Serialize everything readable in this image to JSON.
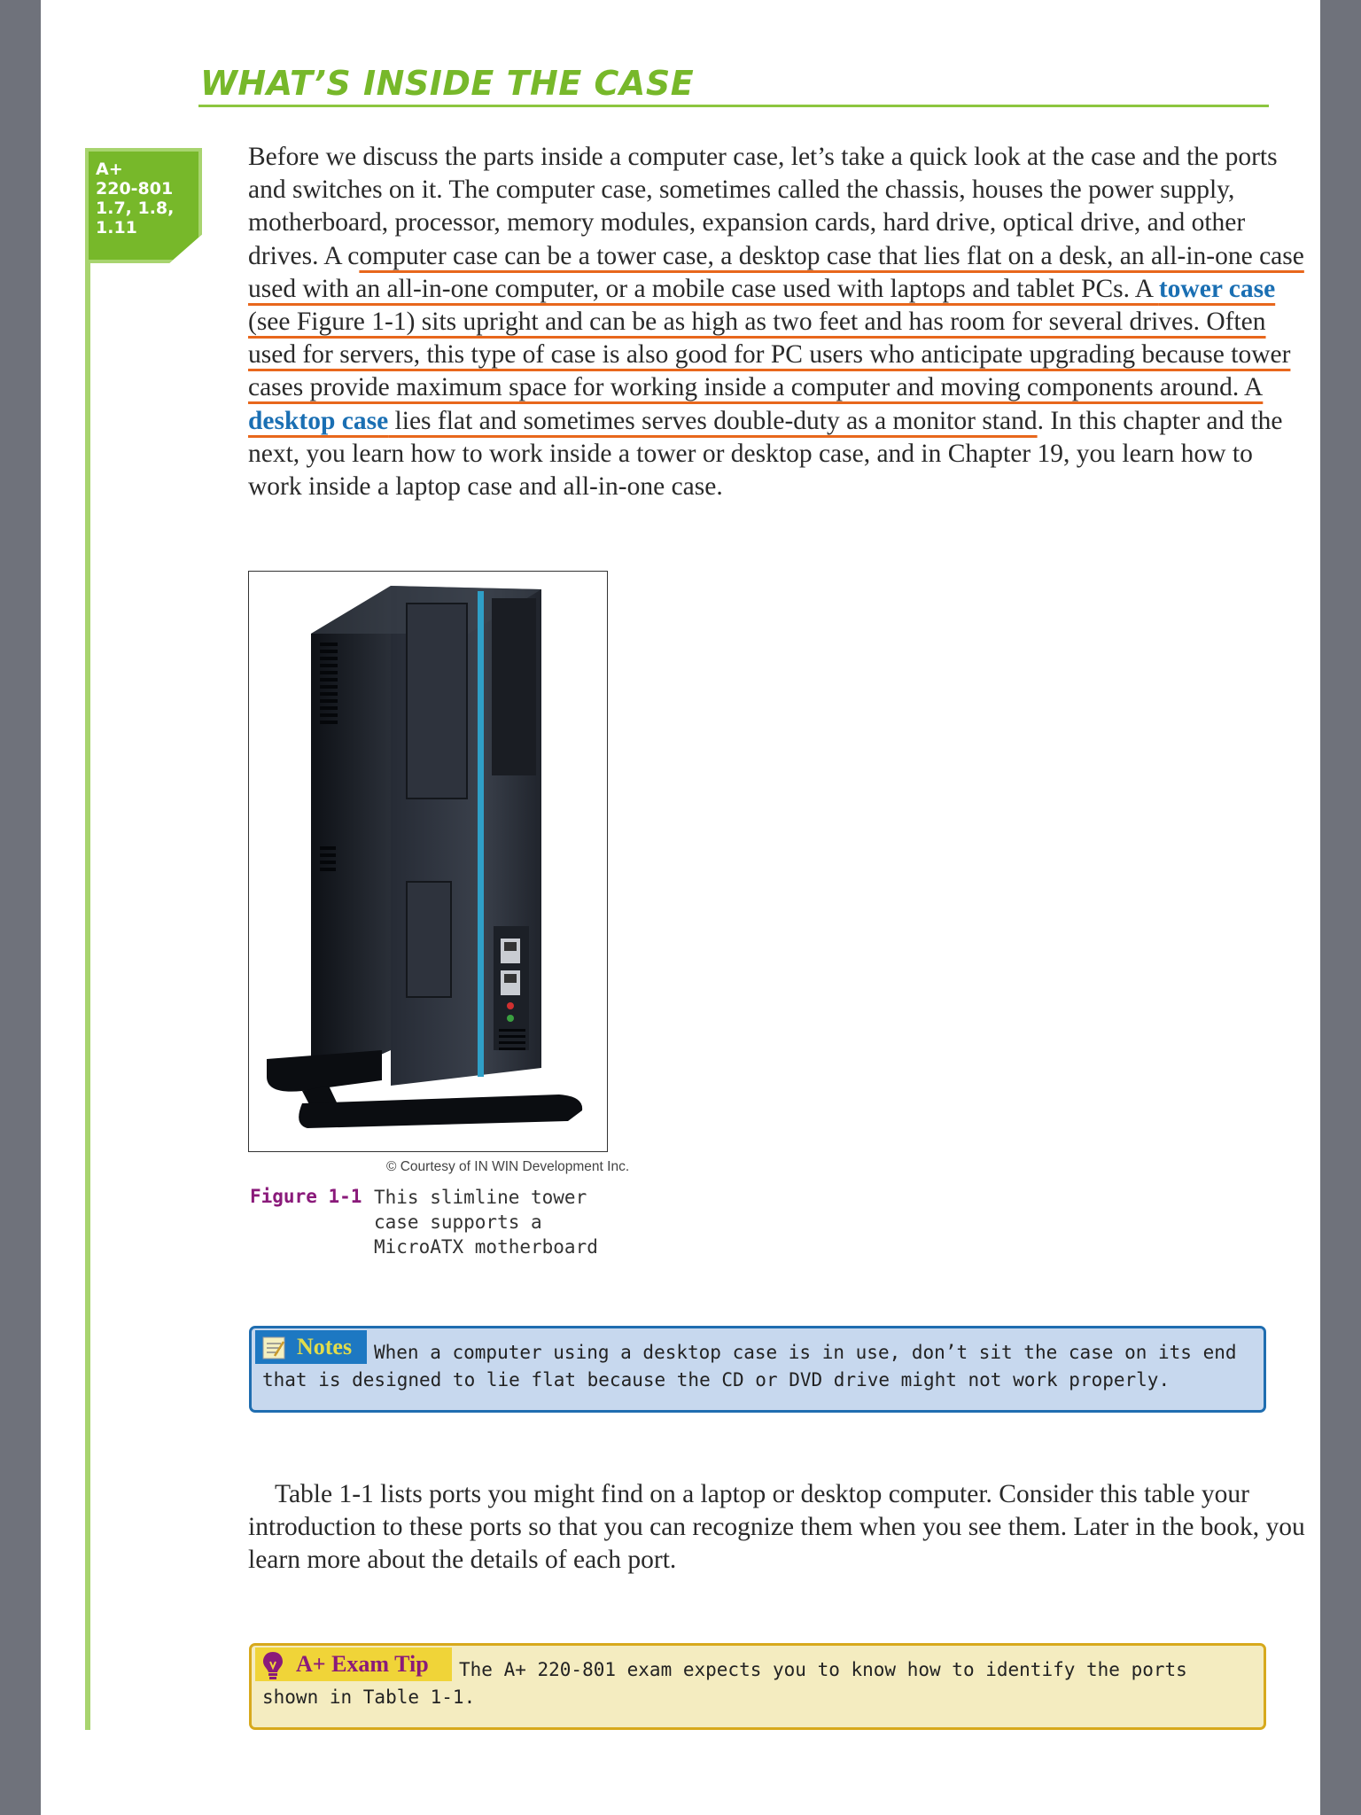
{
  "section": {
    "heading": "WHAT’S INSIDE THE CASE",
    "badge": "A+\n220-801\n1.7, 1.8,\n1.11"
  },
  "paragraph1": {
    "t1": "Before we discuss the parts inside a computer case, let’s take a quick look at the case and the ports and switches on it. The computer case, sometimes called the chassis, houses the power supply, motherboard, processor, memory modules, expansion cards, hard drive, optical drive, and other drives. A c",
    "t2": "omputer case can be a tower case, a desktop case that lies flat on a desk, an all-in-one case used with an all-in-one computer, or a mobile case used with laptops and tablet PCs. A ",
    "term1": "tower case",
    "t3": " (see Figure 1-1) sits upright and can be as high as two feet and has room for several drives. Often used for servers, this type of case is also good for PC users who anticipate upgrading because tower cases provide maximum space for working inside a computer and moving components around. A ",
    "term2": "desktop case",
    "t4": " lies flat and sometimes serves double-duty as a monitor stand",
    "t5": ". In this chapter and the next, you learn how to work inside a tower or desktop case, and in Chapter 19, you learn how to work inside a laptop case and all-in-one case."
  },
  "figure": {
    "credit": "© Courtesy of IN WIN Development Inc.",
    "label": "Figure 1-1",
    "caption": "This slimline tower case supports a MicroATX motherboard"
  },
  "notes": {
    "title": "Notes",
    "text": "When a computer using a desktop case is in use, don’t sit the case on its end that is designed to lie flat because the CD or DVD drive might not work properly.",
    "icon": "notepad-icon"
  },
  "paragraph2": "Table 1-1 lists ports you might find on a laptop or desktop computer. Consider this table your introduction to these ports so that you can recognize them when you see them. Later in the book, you learn more about the details of each port.",
  "tip": {
    "title": "A+ Exam Tip",
    "text": "The A+ 220-801 exam expects you to know how to identify the ports shown in Table 1-1.",
    "icon": "lightbulb-icon"
  },
  "colors": {
    "heading": "#77b82a",
    "term": "#1a6fb3",
    "highlight": "#e8671c",
    "figure_label": "#8a1a7a",
    "notes_bg": "#c7d8ee",
    "tip_bg": "#f4ecc0"
  }
}
